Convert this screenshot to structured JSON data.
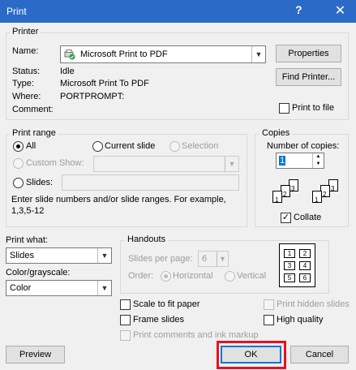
{
  "window": {
    "title": "Print",
    "help_glyph": "?",
    "close_glyph": "✕"
  },
  "printer": {
    "group_label": "Printer",
    "name_label": "Name:",
    "name_value": "Microsoft Print to PDF",
    "properties_button": "Properties",
    "status_label": "Status:",
    "status_value": "Idle",
    "type_label": "Type:",
    "type_value": "Microsoft Print To PDF",
    "where_label": "Where:",
    "where_value": "PORTPROMPT:",
    "comment_label": "Comment:",
    "comment_value": "",
    "find_printer_button": "Find Printer...",
    "print_to_file_label": "Print to file",
    "print_to_file_checked": false
  },
  "print_range": {
    "group_label": "Print range",
    "all_label": "All",
    "current_slide_label": "Current slide",
    "selection_label": "Selection",
    "custom_show_label": "Custom Show:",
    "slides_label": "Slides:",
    "slides_value": "",
    "hint": "Enter slide numbers and/or slide ranges. For example,",
    "hint_example": "1,3,5-12",
    "selected": "all"
  },
  "copies": {
    "group_label": "Copies",
    "number_label": "Number of copies:",
    "number_value": "1",
    "collate_label": "Collate",
    "collate_checked": true,
    "stack1_pages": [
      "1",
      "2",
      "3"
    ],
    "stack2_pages": [
      "1",
      "2",
      "3"
    ]
  },
  "print_what": {
    "label": "Print what:",
    "value": "Slides"
  },
  "color": {
    "label": "Color/grayscale:",
    "value": "Color"
  },
  "handouts": {
    "group_label": "Handouts",
    "slides_per_page_label": "Slides per page:",
    "slides_per_page_value": "6",
    "order_label": "Order:",
    "horizontal_label": "Horizontal",
    "vertical_label": "Vertical",
    "preview_numbers": [
      "1",
      "2",
      "3",
      "4",
      "5",
      "6"
    ]
  },
  "options": {
    "scale_to_fit": "Scale to fit paper",
    "frame_slides": "Frame slides",
    "print_comments": "Print comments and ink markup",
    "print_hidden": "Print hidden slides",
    "high_quality": "High quality"
  },
  "buttons": {
    "preview": "Preview",
    "ok": "OK",
    "cancel": "Cancel"
  },
  "colors": {
    "titlebar": "#2b6bc7",
    "highlight": "#e81123",
    "focus": "#0078d7"
  }
}
